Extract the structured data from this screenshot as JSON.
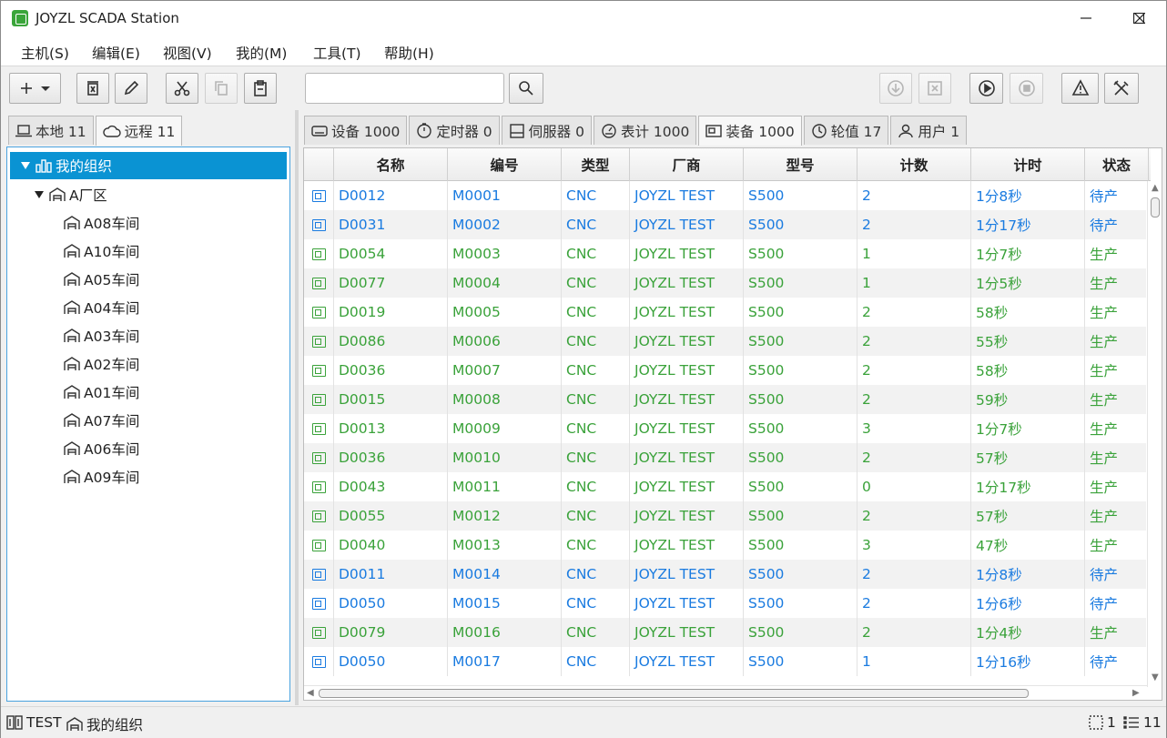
{
  "window": {
    "title": "JOYZL SCADA Station"
  },
  "menu": [
    "主机(S)",
    "编辑(E)",
    "视图(V)",
    "我的(M)",
    "工具(T)",
    "帮助(H)"
  ],
  "search": {
    "value": "",
    "placeholder": ""
  },
  "left_tabs": [
    {
      "label": "本地 11",
      "icon": "laptop-icon",
      "active": false
    },
    {
      "label": "远程 11",
      "icon": "cloud-icon",
      "active": true
    }
  ],
  "tree": {
    "root": "我的组织",
    "area": "A厂区",
    "workshops": [
      "A08车间",
      "A10车间",
      "A05车间",
      "A04车间",
      "A03车间",
      "A02车间",
      "A01车间",
      "A07车间",
      "A06车间",
      "A09车间"
    ]
  },
  "right_tabs": [
    {
      "label": "设备 1000",
      "icon": "device-icon",
      "active": false
    },
    {
      "label": "定时器 0",
      "icon": "timer-icon",
      "active": false
    },
    {
      "label": "伺服器 0",
      "icon": "server-icon",
      "active": false
    },
    {
      "label": "表计 1000",
      "icon": "meter-icon",
      "active": false
    },
    {
      "label": "装备 1000",
      "icon": "equipment-icon",
      "active": true
    },
    {
      "label": "轮值 17",
      "icon": "clock-icon",
      "active": false
    },
    {
      "label": "用户 1",
      "icon": "user-icon",
      "active": false
    }
  ],
  "table": {
    "columns": [
      "名称",
      "编号",
      "类型",
      "厂商",
      "型号",
      "计数",
      "计时",
      "状态"
    ],
    "rows": [
      {
        "name": "D0012",
        "code": "M0001",
        "type": "CNC",
        "vendor": "JOYZL TEST",
        "model": "S500",
        "count": "2",
        "time": "1分8秒",
        "status": "待产",
        "color": "blue"
      },
      {
        "name": "D0031",
        "code": "M0002",
        "type": "CNC",
        "vendor": "JOYZL TEST",
        "model": "S500",
        "count": "2",
        "time": "1分17秒",
        "status": "待产",
        "color": "blue"
      },
      {
        "name": "D0054",
        "code": "M0003",
        "type": "CNC",
        "vendor": "JOYZL TEST",
        "model": "S500",
        "count": "1",
        "time": "1分7秒",
        "status": "生产",
        "color": "green"
      },
      {
        "name": "D0077",
        "code": "M0004",
        "type": "CNC",
        "vendor": "JOYZL TEST",
        "model": "S500",
        "count": "1",
        "time": "1分5秒",
        "status": "生产",
        "color": "green"
      },
      {
        "name": "D0019",
        "code": "M0005",
        "type": "CNC",
        "vendor": "JOYZL TEST",
        "model": "S500",
        "count": "2",
        "time": "58秒",
        "status": "生产",
        "color": "green"
      },
      {
        "name": "D0086",
        "code": "M0006",
        "type": "CNC",
        "vendor": "JOYZL TEST",
        "model": "S500",
        "count": "2",
        "time": "55秒",
        "status": "生产",
        "color": "green"
      },
      {
        "name": "D0036",
        "code": "M0007",
        "type": "CNC",
        "vendor": "JOYZL TEST",
        "model": "S500",
        "count": "2",
        "time": "58秒",
        "status": "生产",
        "color": "green"
      },
      {
        "name": "D0015",
        "code": "M0008",
        "type": "CNC",
        "vendor": "JOYZL TEST",
        "model": "S500",
        "count": "2",
        "time": "59秒",
        "status": "生产",
        "color": "green"
      },
      {
        "name": "D0013",
        "code": "M0009",
        "type": "CNC",
        "vendor": "JOYZL TEST",
        "model": "S500",
        "count": "3",
        "time": "1分7秒",
        "status": "生产",
        "color": "green"
      },
      {
        "name": "D0036",
        "code": "M0010",
        "type": "CNC",
        "vendor": "JOYZL TEST",
        "model": "S500",
        "count": "2",
        "time": "57秒",
        "status": "生产",
        "color": "green"
      },
      {
        "name": "D0043",
        "code": "M0011",
        "type": "CNC",
        "vendor": "JOYZL TEST",
        "model": "S500",
        "count": "0",
        "time": "1分17秒",
        "status": "生产",
        "color": "green"
      },
      {
        "name": "D0055",
        "code": "M0012",
        "type": "CNC",
        "vendor": "JOYZL TEST",
        "model": "S500",
        "count": "2",
        "time": "57秒",
        "status": "生产",
        "color": "green"
      },
      {
        "name": "D0040",
        "code": "M0013",
        "type": "CNC",
        "vendor": "JOYZL TEST",
        "model": "S500",
        "count": "3",
        "time": "47秒",
        "status": "生产",
        "color": "green"
      },
      {
        "name": "D0011",
        "code": "M0014",
        "type": "CNC",
        "vendor": "JOYZL TEST",
        "model": "S500",
        "count": "2",
        "time": "1分8秒",
        "status": "待产",
        "color": "blue"
      },
      {
        "name": "D0050",
        "code": "M0015",
        "type": "CNC",
        "vendor": "JOYZL TEST",
        "model": "S500",
        "count": "2",
        "time": "1分6秒",
        "status": "待产",
        "color": "blue"
      },
      {
        "name": "D0079",
        "code": "M0016",
        "type": "CNC",
        "vendor": "JOYZL TEST",
        "model": "S500",
        "count": "2",
        "time": "1分4秒",
        "status": "生产",
        "color": "green"
      },
      {
        "name": "D0050",
        "code": "M0017",
        "type": "CNC",
        "vendor": "JOYZL TEST",
        "model": "S500",
        "count": "1",
        "time": "1分16秒",
        "status": "待产",
        "color": "blue"
      }
    ]
  },
  "colors": {
    "blue": "#1a7be0",
    "green": "#3aa23a",
    "selection": "#0a93d3"
  },
  "status": {
    "left_user": "TEST",
    "left_org": "我的组织",
    "right_a": "1",
    "right_b": "11"
  }
}
